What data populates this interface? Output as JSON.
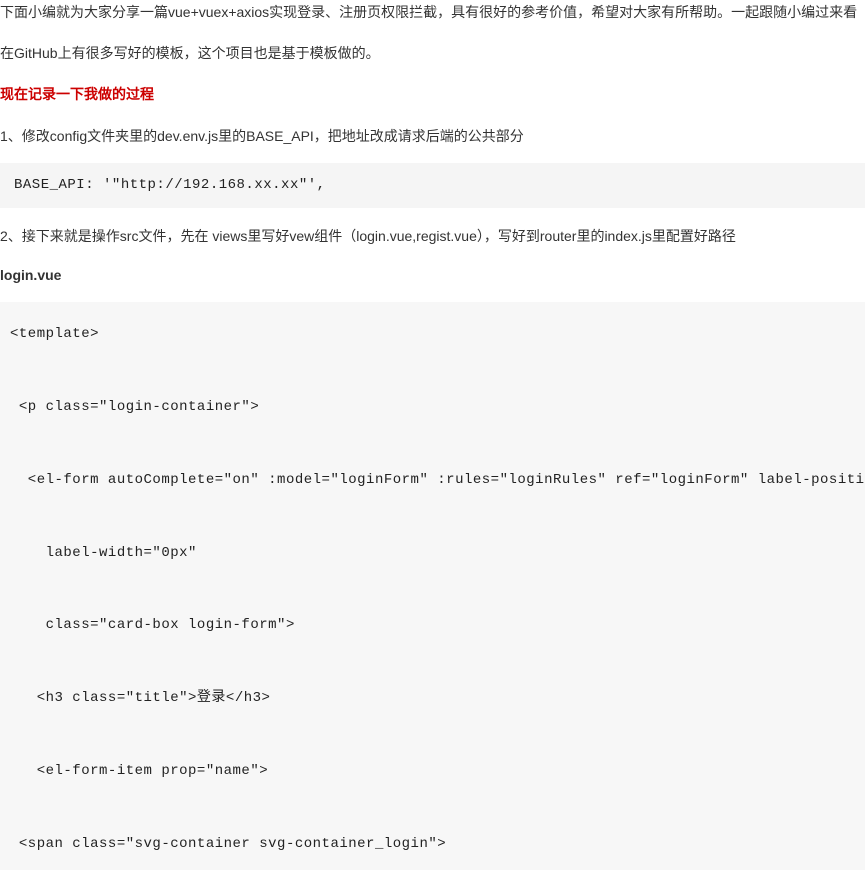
{
  "intro_para": "下面小编就为大家分享一篇vue+vuex+axios实现登录、注册页权限拦截，具有很好的参考价值，希望对大家有所帮助。一起跟随小编过来看",
  "github_para": "在GitHub上有很多写好的模板，这个项目也是基于模板做的。",
  "highlight_heading": "现在记录一下我做的过程",
  "step1": "1、修改config文件夹里的dev.env.js里的BASE_API，把地址改成请求后端的公共部分",
  "code1": "BASE_API: '\"http://192.168.xx.xx\"',",
  "step2": "2、接下来就是操作src文件，先在 views里写好vew组件（login.vue,regist.vue），写好到router里的index.js里配置好路径",
  "filename": "login.vue",
  "code2_line1": "<template>",
  "code2_line2": " <p class=\"login-container\">",
  "code2_line3": "  <el-form autoComplete=\"on\" :model=\"loginForm\" :rules=\"loginRules\" ref=\"loginForm\" label-position=\"left\"",
  "code2_line4": "    label-width=\"0px\"",
  "code2_line5": "    class=\"card-box login-form\">",
  "code2_line6": "   <h3 class=\"title\">登录</h3>",
  "code2_line7": "   <el-form-item prop=\"name\">",
  "code2_line8": " <span class=\"svg-container svg-container_login\">"
}
